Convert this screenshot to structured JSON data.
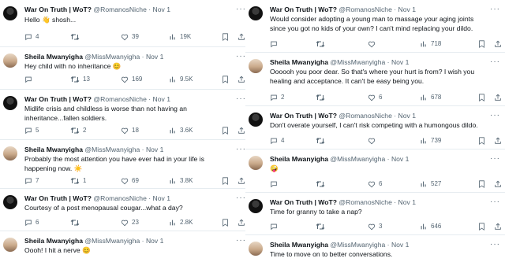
{
  "left_column": [
    {
      "author_name": "War On Truth | WoT?",
      "handle": "@RomanosNiche",
      "dot": "·",
      "date": "Nov 1",
      "text": "Hello 👋 shosh...",
      "replies": "4",
      "reposts": "",
      "likes": "39",
      "views": "19K",
      "avatar": "dark"
    },
    {
      "author_name": "Sheila Mwanyigha",
      "handle": "@MissMwanyigha",
      "dot": "·",
      "date": "Nov 1",
      "text": "Hey child with no inheritance 😊",
      "replies": "",
      "reposts": "13",
      "likes": "169",
      "views": "9.5K",
      "avatar": "light"
    },
    {
      "author_name": "War On Truth | WoT?",
      "handle": "@RomanosNiche",
      "dot": "·",
      "date": "Nov 1",
      "text": "Midlife crisis and childless is worse than not having an inheritance...fallen soldiers.",
      "replies": "5",
      "reposts": "2",
      "likes": "18",
      "views": "3.6K",
      "avatar": "dark"
    },
    {
      "author_name": "Sheila Mwanyigha",
      "handle": "@MissMwanyigha",
      "dot": "·",
      "date": "Nov 1",
      "text": "Probably the most attention you have ever had in your life is happening now. ☀️",
      "replies": "7",
      "reposts": "1",
      "likes": "69",
      "views": "3.8K",
      "avatar": "light"
    },
    {
      "author_name": "War On Truth | WoT?",
      "handle": "@RomanosNiche",
      "dot": "·",
      "date": "Nov 1",
      "text": "Courtesy of a post menopausal cougar...what a day?",
      "replies": "6",
      "reposts": "",
      "likes": "23",
      "views": "2.8K",
      "avatar": "dark"
    },
    {
      "author_name": "Sheila Mwanyigha",
      "handle": "@MissMwanyigha",
      "dot": "·",
      "date": "Nov 1",
      "text": "Oooh! I hit a nerve 😊",
      "avatar": "light"
    }
  ],
  "right_column": [
    {
      "author_name": "War On Truth | WoT?",
      "handle": "@RomanosNiche",
      "dot": "·",
      "date": "Nov 1",
      "text": "Would consider adopting a young man to massage your aging joints since you got no kids of your own? I can't mind replacing your dildo.",
      "replies": "",
      "reposts": "",
      "likes": "",
      "views": "718",
      "avatar": "dark"
    },
    {
      "author_name": "Sheila Mwanyigha",
      "handle": "@MissMwanyigha",
      "dot": "·",
      "date": "Nov 1",
      "text": "Oooooh you poor dear. So that's where your hurt is from? I wish you healing and acceptance. It can't be easy being you.",
      "replies": "2",
      "reposts": "",
      "likes": "6",
      "views": "678",
      "avatar": "light"
    },
    {
      "author_name": "War On Truth | WoT?",
      "handle": "@RomanosNiche",
      "dot": "·",
      "date": "Nov 1",
      "text": "Don't overate yourself, I can't risk competing with a humongous dildo.",
      "replies": "4",
      "reposts": "",
      "likes": "",
      "views": "739",
      "avatar": "dark"
    },
    {
      "author_name": "Sheila Mwanyigha",
      "handle": "@MissMwanyigha",
      "dot": "·",
      "date": "Nov 1",
      "text": "🤪",
      "replies": "",
      "reposts": "",
      "likes": "6",
      "views": "527",
      "avatar": "light"
    },
    {
      "author_name": "War On Truth | WoT?",
      "handle": "@RomanosNiche",
      "dot": "·",
      "date": "Nov 1",
      "text": "Time for granny to take a nap?",
      "replies": "",
      "reposts": "",
      "likes": "3",
      "views": "646",
      "avatar": "dark"
    },
    {
      "author_name": "Sheila Mwanyigha",
      "handle": "@MissMwanyigha",
      "dot": "·",
      "date": "Nov 1",
      "text": "Time to move on to better conversations.",
      "avatar": "light"
    }
  ],
  "colors": {
    "text": "#0f1419",
    "muted": "#536471",
    "divider": "#e6ecf0"
  }
}
